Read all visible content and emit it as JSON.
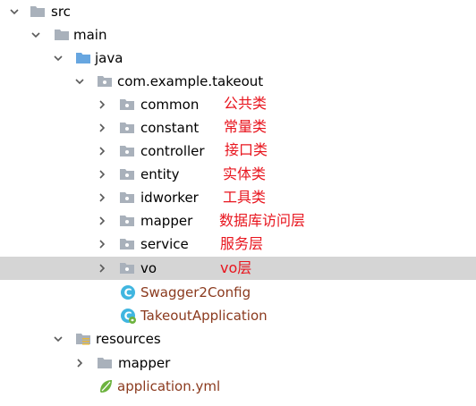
{
  "tree": {
    "src": "src",
    "main": "main",
    "java": "java",
    "package": "com.example.takeout",
    "packages": [
      {
        "name": "common"
      },
      {
        "name": "constant"
      },
      {
        "name": "controller"
      },
      {
        "name": "entity"
      },
      {
        "name": "idworker"
      },
      {
        "name": "mapper"
      },
      {
        "name": "service"
      },
      {
        "name": "vo",
        "selected": true
      }
    ],
    "classes": [
      "Swagger2Config",
      "TakeoutApplication"
    ],
    "resources": "resources",
    "res_mapper": "mapper",
    "app_yml": "application.yml"
  },
  "annotations": [
    "公共类",
    "常量类",
    "接口类",
    "实体类",
    "工具类",
    "数据库访问层",
    "服务层",
    "vo层"
  ],
  "colors": {
    "annotation": "#e8151e",
    "class_text": "#8b3a1e",
    "selection": "#d5d5d5",
    "folder": "#a9b1bb",
    "source_folder": "#67a6e0",
    "class_icon": "#40b6e0"
  }
}
